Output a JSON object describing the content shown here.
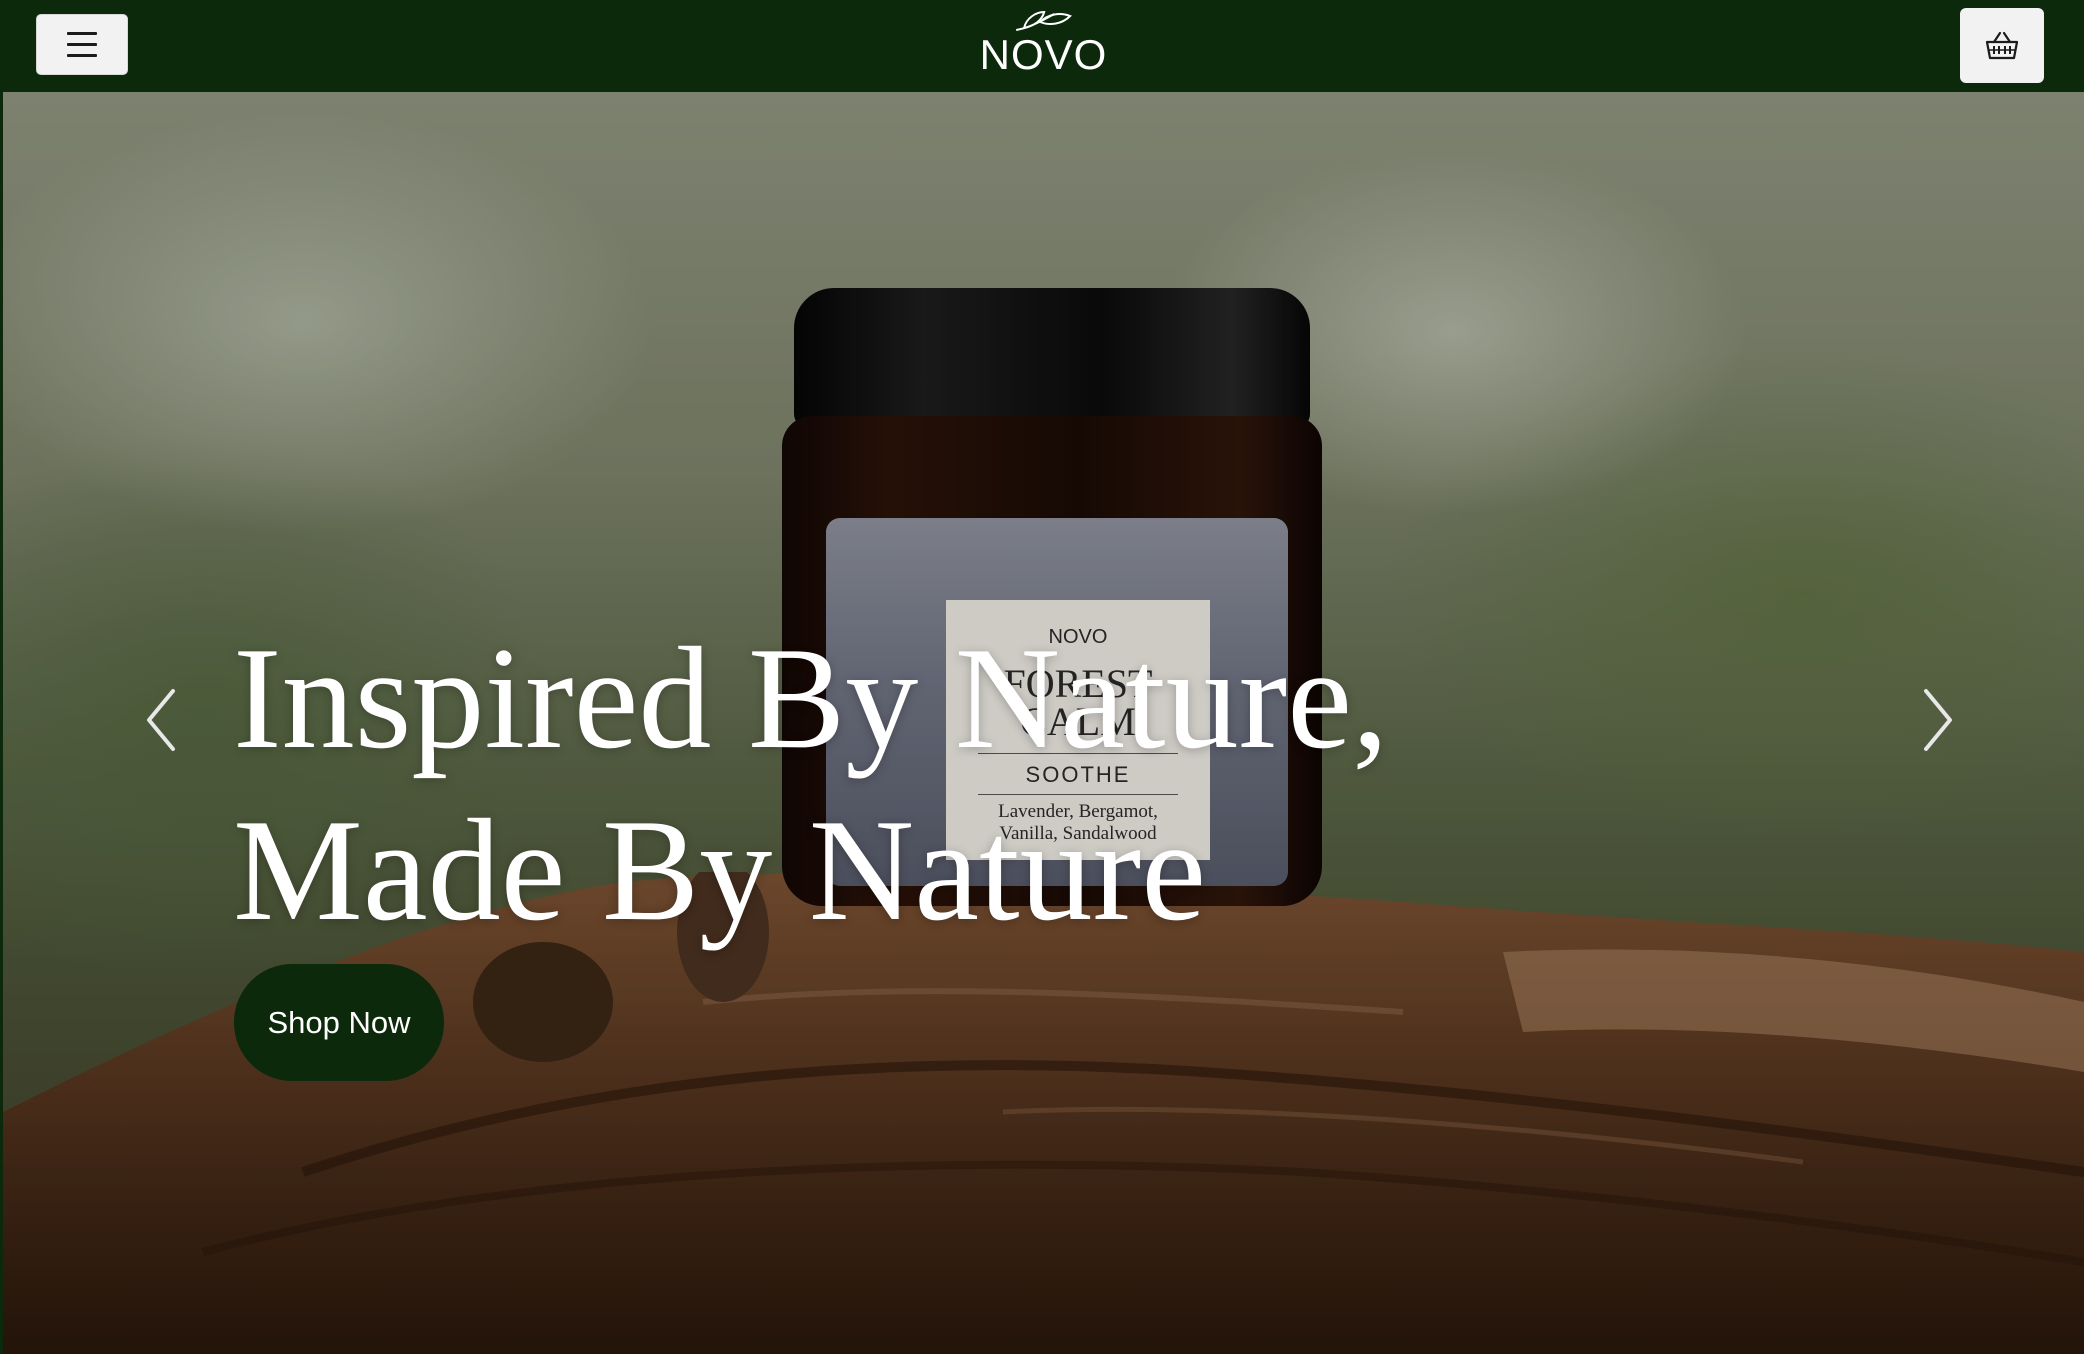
{
  "header": {
    "menu_icon": "hamburger-menu-icon",
    "logo_text": "NOVO",
    "logo_icon": "leaf-icon",
    "cart_icon": "shopping-basket-icon"
  },
  "hero": {
    "headline": "Inspired By Nature, Made By Nature",
    "cta_label": "Shop Now",
    "prev_icon": "chevron-left-icon",
    "next_icon": "chevron-right-icon",
    "product_label": {
      "brand": "NOVO",
      "title": "FOREST CALM",
      "subtitle": "SOOTHE",
      "notes": "Lavender, Bergamot, Vanilla, Sandalwood"
    }
  },
  "colors": {
    "brand_green": "#0c2a0b",
    "button_light": "#f2f2f2",
    "text_light": "#ffffff"
  }
}
